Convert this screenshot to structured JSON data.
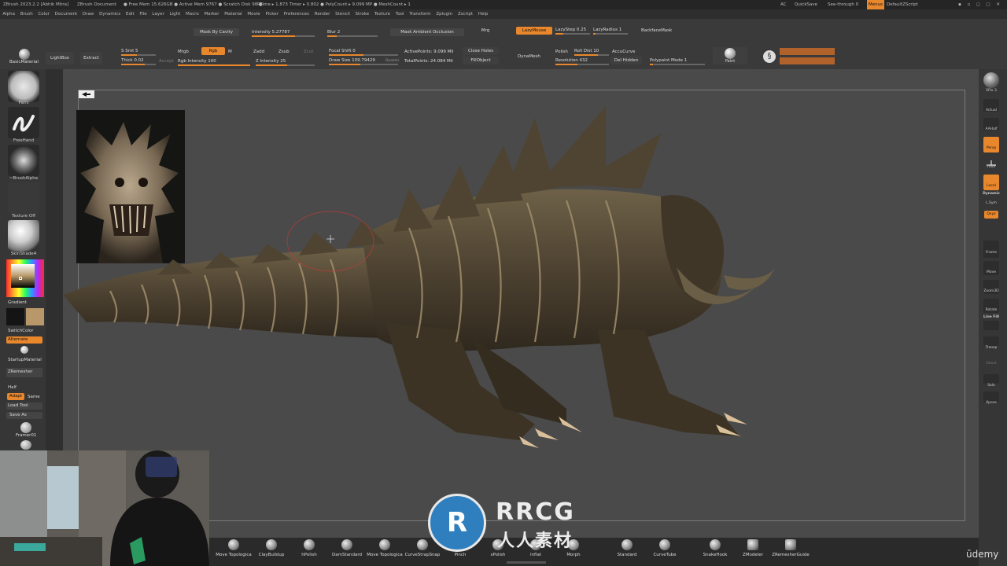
{
  "title_bar": {
    "app": "ZBrush 2023.2.2 [Abhik Mitra]",
    "document": "ZBrush Document",
    "stats": "● Free Mem 15.626GB ● Active Mem 9767 ● Scratch Disk 98 ●",
    "timers": "RTime ▸ 1.873 Timer ▸ 0.802 ● PolyCount ▸ 9.099 MP ● MeshCount ▸ 1",
    "ac": "AC",
    "quicksave": "QuickSave",
    "seethrough": "See-through 0",
    "menus_btn": "Menus",
    "default_script": "DefaultZScript"
  },
  "menu": [
    "Alpha",
    "Brush",
    "Color",
    "Document",
    "Draw",
    "Dynamics",
    "Edit",
    "File",
    "Layer",
    "Light",
    "Macro",
    "Marker",
    "Material",
    "Movie",
    "Picker",
    "Preferences",
    "Render",
    "Stencil",
    "Stroke",
    "Texture",
    "Tool",
    "Transform",
    "Zplugin",
    "Zscript",
    "Help"
  ],
  "toolbar": {
    "mask_by_cavity": "Mask By Cavity",
    "intensity": "Intensity 5.27787",
    "blur": "Blur 2",
    "mask_ambient": "Mask Ambient Occlusion",
    "mrg_top": "Mrg",
    "lazymouse": "LazyMouse",
    "lazystep": "LazyStep 0.25",
    "lazyradius": "LazyRadius 1",
    "backface": "BackfaceMask",
    "material": "BasicMaterial",
    "lightbox": "LightBox",
    "extract": "Extract",
    "s_smt": "S Smt 5",
    "thick": "Thick 0.02",
    "accept": "Accept",
    "mrgb": "Mrgb",
    "rgb": "Rgb",
    "m": "M",
    "rgb_intensity": "Rgb Intensity 100",
    "zadd": "Zadd",
    "zsub": "Zsub",
    "zcut": "Zcut",
    "z_intensity": "Z Intensity 25",
    "focal_shift": "Focal Shift 0",
    "draw_size": "Draw Size 109.79429",
    "dynamic": "Dynamic",
    "active_points": "ActivePoints: 9.099 Mil",
    "total_points": "TotalPoints: 24.084 Mil",
    "close_holes": "Close Holes",
    "fill_object": "FillObject",
    "dynamesh": "DynaMesh",
    "polish": "Polish",
    "roll_dist": "Roll Dist 10",
    "resolution": "Resolution 432",
    "accucurve": "AccuCurve",
    "del_hidden": "Del Hidden",
    "polypaint_mode": "Polypaint Mode 1",
    "paint": "Paint"
  },
  "left_shelf": {
    "pairs": "Pairs",
    "freehand": "FreeHand",
    "brush_alpha": "~BrushAlpha",
    "texture_off": "Texture Off",
    "skin_shade": "SkinShade4",
    "gradient": "Gradient",
    "switch_color": "SwitchColor",
    "alternate": "Alternate",
    "startup_material": "StartupMaterial",
    "zremesher": "ZRemesher",
    "half": "Half",
    "adapt": "Adapt",
    "same": "Same",
    "load_tool": "Load Tool",
    "save_as": "Save As",
    "framer": "Framer01"
  },
  "right_shelf": [
    "SPix 3",
    "Actual",
    "AAHalf",
    "Persp",
    "Floor",
    "Local",
    "Dynamic",
    "L.Sym",
    "Qxyz",
    "Frame",
    "Move",
    "Zoom3D",
    "Rotate",
    "Line Fill",
    "Transp",
    "Ghost",
    "Solo",
    "Xpose"
  ],
  "bottom_brushes": [
    "Move Topologica",
    "ClayBuildup",
    "hPolish",
    "DamStandard",
    "Move Topologica",
    "CurveStrapSnap",
    "Pinch",
    "sPolish",
    "Inflat",
    "Morph",
    "Standard",
    "CurveTube",
    "SnakeHook",
    "ZModeler",
    "ZRemesherGuide"
  ],
  "watermark": {
    "main": "RRCG",
    "sub": "人人素材"
  },
  "udemy": "ūdemy",
  "colors": {
    "accent": "#e8872c",
    "primary_color": "#141414",
    "secondary_color": "#b8976a"
  }
}
